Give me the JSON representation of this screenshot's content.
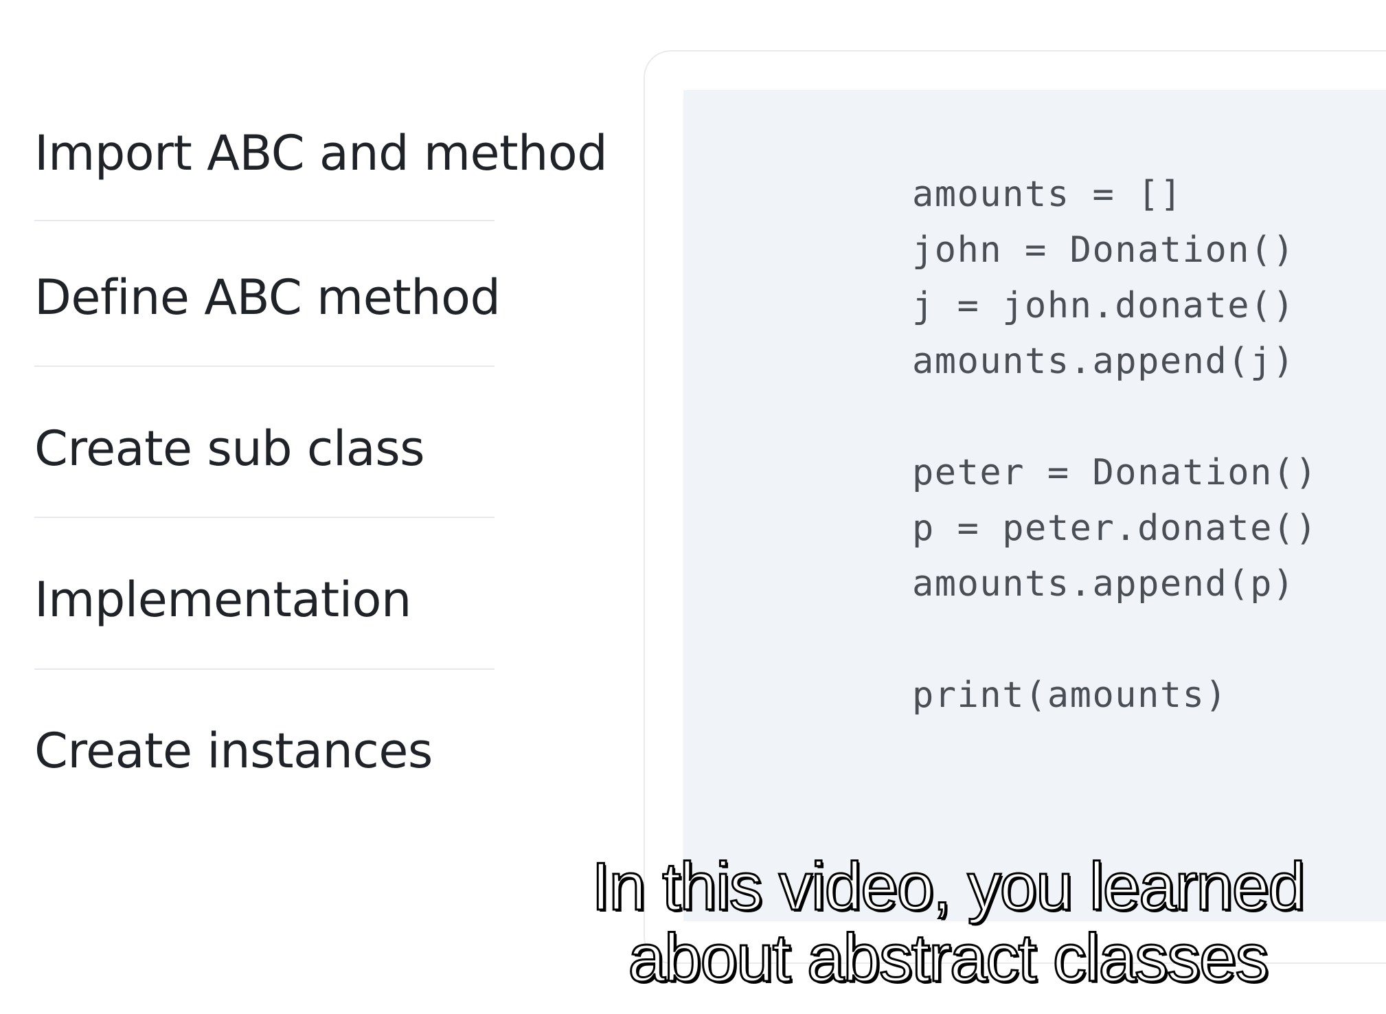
{
  "steps": [
    {
      "label": "Import ABC and method"
    },
    {
      "label": "Define ABC method"
    },
    {
      "label": "Create sub class"
    },
    {
      "label": "Implementation"
    },
    {
      "label": "Create instances"
    }
  ],
  "code": {
    "lines": [
      "amounts = []",
      "john = Donation()",
      "j = john.donate()",
      "amounts.append(j)",
      "",
      "peter = Donation()",
      "p = peter.donate()",
      "amounts.append(p)",
      "",
      "print(amounts)"
    ]
  },
  "caption": {
    "line1": "In this video, you learned",
    "line2": "about abstract classes"
  },
  "colors": {
    "code_background": "#f0f3f7",
    "code_text": "#4a4f55",
    "step_text": "#1f2328",
    "divider": "#e6e8eb"
  }
}
